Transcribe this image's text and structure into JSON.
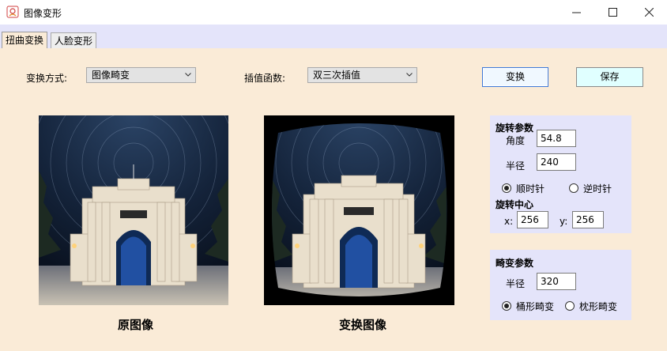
{
  "window": {
    "title": "图像变形",
    "minimize_icon": "minimize-icon",
    "maximize_icon": "maximize-icon",
    "close_icon": "close-icon"
  },
  "tabs": [
    {
      "label": "扭曲变换",
      "active": true
    },
    {
      "label": "人脸变形",
      "active": false
    }
  ],
  "controls": {
    "mode_label": "变换方式:",
    "mode_value": "图像畸变",
    "interp_label": "插值函数:",
    "interp_value": "双三次插值",
    "transform_button": "变换",
    "save_button": "保存"
  },
  "images": {
    "original_caption": "原图像",
    "transformed_caption": "变换图像"
  },
  "rotation_panel": {
    "title": "旋转参数",
    "angle_label": "角度",
    "angle_value": "54.8",
    "radius_label": "半径",
    "radius_value": "240",
    "clockwise_label": "顺时针",
    "counterclockwise_label": "逆时针",
    "direction_selected": "顺时针",
    "center_title": "旋转中心",
    "x_label": "x:",
    "x_value": "256",
    "y_label": "y:",
    "y_value": "256"
  },
  "distortion_panel": {
    "title": "畸变参数",
    "radius_label": "半径",
    "radius_value": "320",
    "barrel_label": "桶形畸变",
    "pincushion_label": "枕形畸变",
    "type_selected": "桶形畸变"
  },
  "colors": {
    "content_bg": "#faebd7",
    "tabstrip_bg": "#e4e4fa",
    "panel_bg": "#e4e4fa",
    "save_button_bg": "#e0ffff",
    "transform_button_bg": "#f0f8ff"
  }
}
